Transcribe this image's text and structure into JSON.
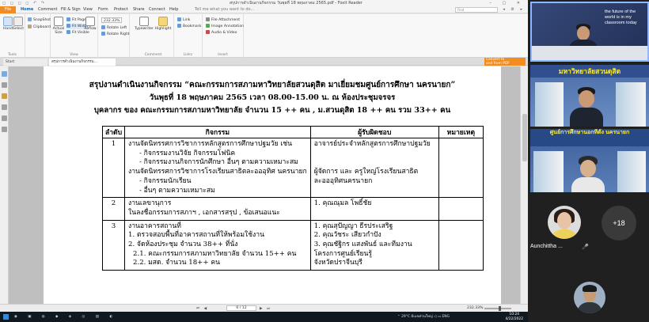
{
  "window": {
    "title": "สรุปการดำเนินงานกิจกรรม วันพุธที่ 18 พฤษภาคม 2565.pdf - Foxit Reader",
    "quick_access": "◻ ◻ ◻ ◻ ↶ ↷",
    "controls": "– ▢ ✕"
  },
  "ribbon_tabs": {
    "file": "File",
    "tabs": [
      "Home",
      "Comment",
      "Fill & Sign",
      "View",
      "Form",
      "Protect",
      "Share",
      "Connect",
      "Help"
    ],
    "tell_me": "Tell me what you want to do...",
    "find_placeholder": "Find",
    "right_icons": "◂ ⚙ ▸"
  },
  "ribbon": {
    "tools": {
      "hand": "Hand",
      "select": "Select",
      "group_label": "Tools"
    },
    "clip": {
      "snapshot": "SnapShot",
      "clipboard": "Clipboard",
      "group_label": ""
    },
    "zoom": {
      "actual_size": "Actual Size",
      "fit_page": "Fit Page",
      "fit_width": "Fit Width",
      "fit_visible": "Fit Visible",
      "reflow": "Reflow",
      "group_label": "View"
    },
    "view2": {
      "zoom": "232.33%",
      "rotate_left": "Rotate Left",
      "rotate_right": "Rotate Right"
    },
    "comment": {
      "typewriter": "Typewriter",
      "highlight": "Highlight",
      "group_label": "Comment"
    },
    "links": {
      "link": "Link",
      "bookmark": "Bookmark",
      "group_label": "Links"
    },
    "insert": {
      "file_attachment": "File Attachment",
      "image_annotation": "Image Annotation",
      "audio_video": "Audio & Video",
      "group_label": "Insert"
    }
  },
  "doc_tabs": {
    "start": "Start",
    "document": "สรุปการดำเนินงานกิจกรรม...",
    "convert_line1": "Convert to",
    "convert_line2": "and from PDF"
  },
  "document": {
    "heading1": "สรุปงานดำเนินงานกิจกรรม  “คณะกรรมการสภามหาวิทยาลัยสวนดุสิต มาเยี่ยมชมศูนย์การศึกษา นครนายก”",
    "heading2": "วันพุธที่ 18 พฤษภาคม  2565  เวลา 08.00-15.00 น.  ณ ห้องประชุมจรจร",
    "heading3": "บุคลากร ของ  คณะกรรมการสภามหาวิทยาลัย จำนวน 15 ++ คน , ม.สวนดุสิต 18 ++  คน รวม  33++ คน",
    "table": {
      "headers": [
        "ลำดับ",
        "กิจกรรม",
        "ผู้รับผิดชอบ",
        "หมายเหตุ"
      ],
      "rows": [
        {
          "num": "1",
          "activity": [
            "งานจัดนิทรรศการวิชาการหลักสูตรการศึกษาปฐมวัย เช่น",
            "-     กิจกรรมงานวิจัย  กิจกรรมโฟนิค",
            "-     กิจกรรมงานกิจการนักศึกษา อื่นๆ ตามความเหมาะสม",
            "งานจัดนิทรรศการวิชาการโรงเรียนสาธิตละอออุทิศ นครนายก",
            "-     กิจกรรมนักเรียน",
            "-     อื่นๆ ตามความเหมาะสม"
          ],
          "responsible": [
            "อาจารย์ประจำหลักสูตรการศึกษาปฐมวัย",
            "",
            "",
            "ผู้จัดการ และ ครูใหญ่โรงเรียนสาธิต",
            "ละอออุทิศนครนายก",
            ""
          ],
          "note": ""
        },
        {
          "num": "2",
          "activity": [
            "งานเลขานุการ",
            "ในลงชื่อกรรมการสภาฯ , เอกสารสรุป , ข้อเสนอแนะ"
          ],
          "responsible": [
            "1. คุณณุมล โพธิ์ชัย"
          ],
          "note": ""
        },
        {
          "num": "3",
          "activity": [
            "งานอาคารสถานที่",
            "1.  ตรวจสอบพื้นที่อาคารสถานที่ให้พร้อมใช้งาน",
            "2.  จัดห้องประชุม จำนวน 38++ ที่นั่ง",
            "2.1.  คณะกรรมการสภามหาวิทยาลัย  จำนวน 15++ คน",
            "2.2.  มสด. จำนวน   18++ คน"
          ],
          "responsible": [
            "1. คุณสุปัญญา  ธีรประเสริฐ",
            "2. คุณวัชระ  เสียวกำปัง",
            "3. คุณชัฐิกร  แสงพันธ์ และทีมงาน",
            "โครงการศูนย์เรียนรู้",
            "จังหวัดปราจีนบุรี"
          ],
          "note": ""
        }
      ]
    }
  },
  "status_bar": {
    "nav": "⏮ ◀",
    "page": "6 / 12",
    "nav_after": "▶ ⏭",
    "zoom": "232.33%"
  },
  "taskbar": {
    "apps": "◉ ▣ ◍ ◆ ◈ ◎ ▤ ◐",
    "tray": "⌃ 29°C  มีเมฆส่วนใหญ่  ◁ ▭  ENG",
    "time": "10:24",
    "date": "4/22/2022"
  },
  "meeting": {
    "tile1_slogan": "the future of the world is in my classroom today",
    "tile2_banner": "มหาวิทยาลัยสวนดุสิต",
    "tile3_banner": "ศูนย์การศึกษานอกที่ตั้ง นครนายก",
    "more_count": "+18",
    "participant_name": "Aunchittha ...",
    "mic_icon": "🎤"
  },
  "colors": {
    "foxit_orange": "#f28c1e",
    "active_speaker_border": "#8fb7ff",
    "banner_yellow": "#ffec3a"
  }
}
